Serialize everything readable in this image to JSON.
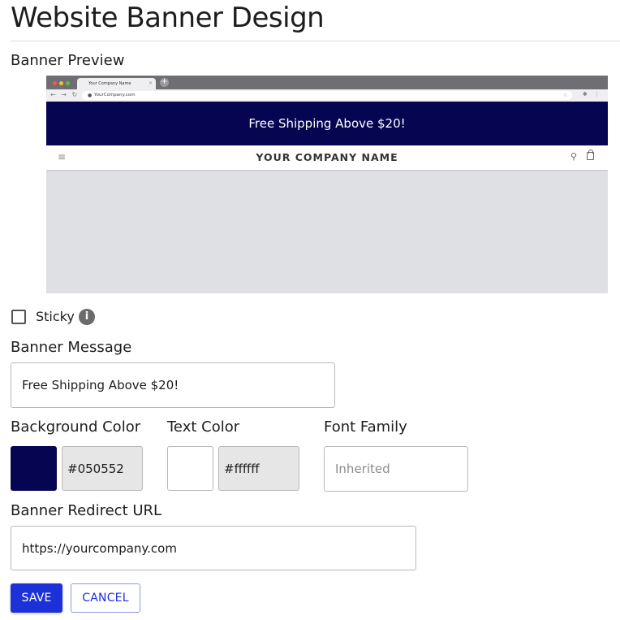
{
  "page": {
    "title": "Website Banner Design"
  },
  "preview": {
    "label": "Banner Preview",
    "browser": {
      "tab_title": "Your Company Name",
      "tab_close": "×",
      "new_tab": "+",
      "nav_glyphs": "← → ↻",
      "url": "YourCompany.com",
      "lock_glyph": "🔒",
      "star_glyph": "☆",
      "ext_glyphs": "✱ ⋮"
    },
    "banner_text": "Free Shipping Above $20!",
    "banner_bg": "#050552",
    "banner_fg": "#ffffff",
    "site": {
      "menu_glyph": "≡",
      "company_name": "YOUR COMPANY NAME",
      "search_glyph": "⚲"
    }
  },
  "sticky": {
    "label": "Sticky",
    "checked": false,
    "info_glyph": "i"
  },
  "banner_message": {
    "label": "Banner Message",
    "value": "Free Shipping Above $20!"
  },
  "background_color": {
    "label": "Background Color",
    "swatch": "#050552",
    "value": "#050552"
  },
  "text_color": {
    "label": "Text Color",
    "swatch": "#ffffff",
    "value": "#ffffff"
  },
  "font_family": {
    "label": "Font Family",
    "placeholder": "Inherited"
  },
  "redirect_url": {
    "label": "Banner Redirect URL",
    "value": "https://yourcompany.com"
  },
  "actions": {
    "save": "SAVE",
    "cancel": "CANCEL"
  },
  "colors": {
    "primary": "#1c31d8"
  }
}
